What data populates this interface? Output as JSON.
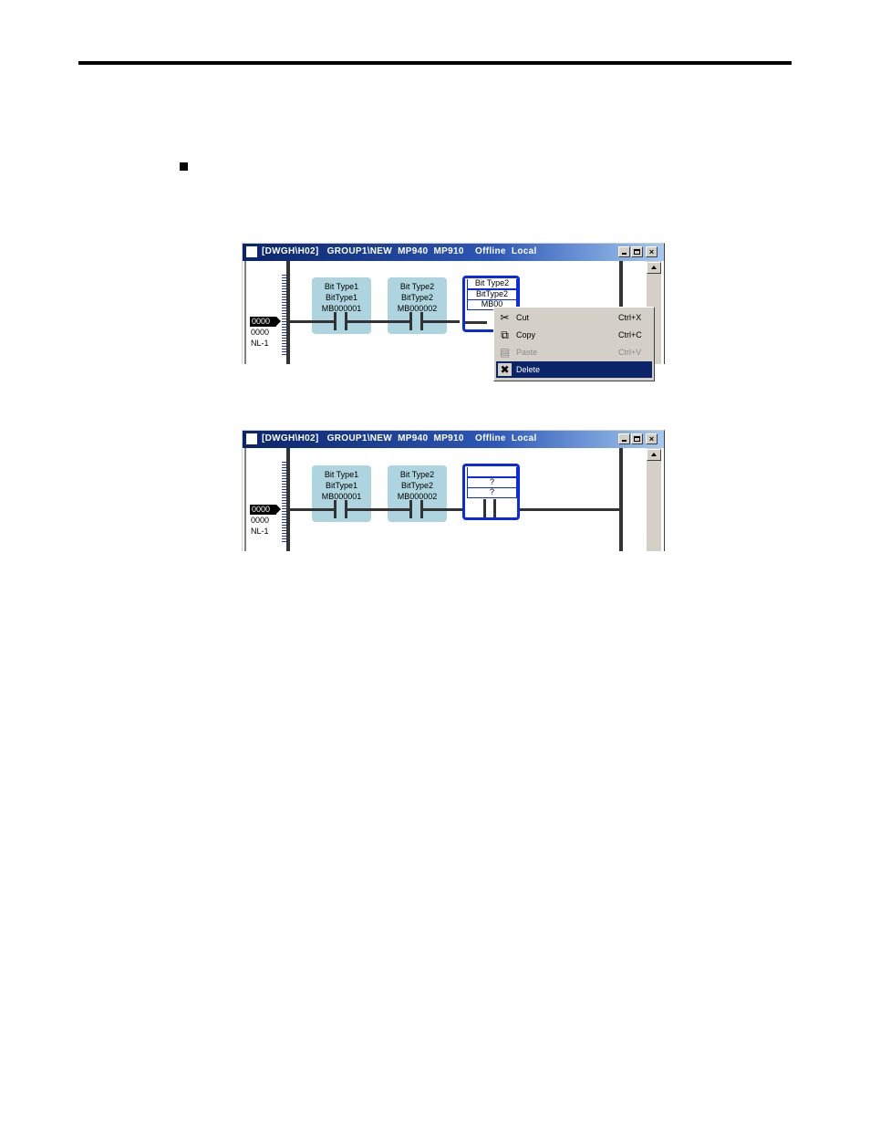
{
  "window_title": "[DWGH\\H02]   GROUP1\\NEW  MP940  MP910    Offline  Local",
  "window_buttons": {
    "minimize": "_",
    "maximize": "□",
    "close": "×"
  },
  "network": {
    "number": "0000",
    "step": "0000",
    "label": "NL-1"
  },
  "cells": [
    {
      "line1": "Bit Type1",
      "line2": "BitType1",
      "line3": "MB000001"
    },
    {
      "line1": "Bit Type2",
      "line2": "BitType2",
      "line3": "MB000002"
    }
  ],
  "selected_cell_before": {
    "line1": "Bit Type2",
    "line2": "BitType2",
    "line3": "MB00"
  },
  "selected_cell_after": {
    "line1": "",
    "line2": "?",
    "line3": "?"
  },
  "context_menu": [
    {
      "icon": "scissors-icon",
      "label": "Cut",
      "shortcut": "Ctrl+X",
      "enabled": true,
      "highlighted": false
    },
    {
      "icon": "copy-icon",
      "label": "Copy",
      "shortcut": "Ctrl+C",
      "enabled": true,
      "highlighted": false
    },
    {
      "icon": "paste-icon",
      "label": "Paste",
      "shortcut": "Ctrl+V",
      "enabled": false,
      "highlighted": false
    },
    {
      "icon": "delete-x-icon",
      "label": "Delete",
      "shortcut": "",
      "enabled": true,
      "highlighted": true
    }
  ],
  "colors": {
    "titlebar": "#0a246a",
    "cell_fill": "#aed4e0",
    "selection": "#0b2ae8",
    "menu_highlight": "#0a246a"
  }
}
